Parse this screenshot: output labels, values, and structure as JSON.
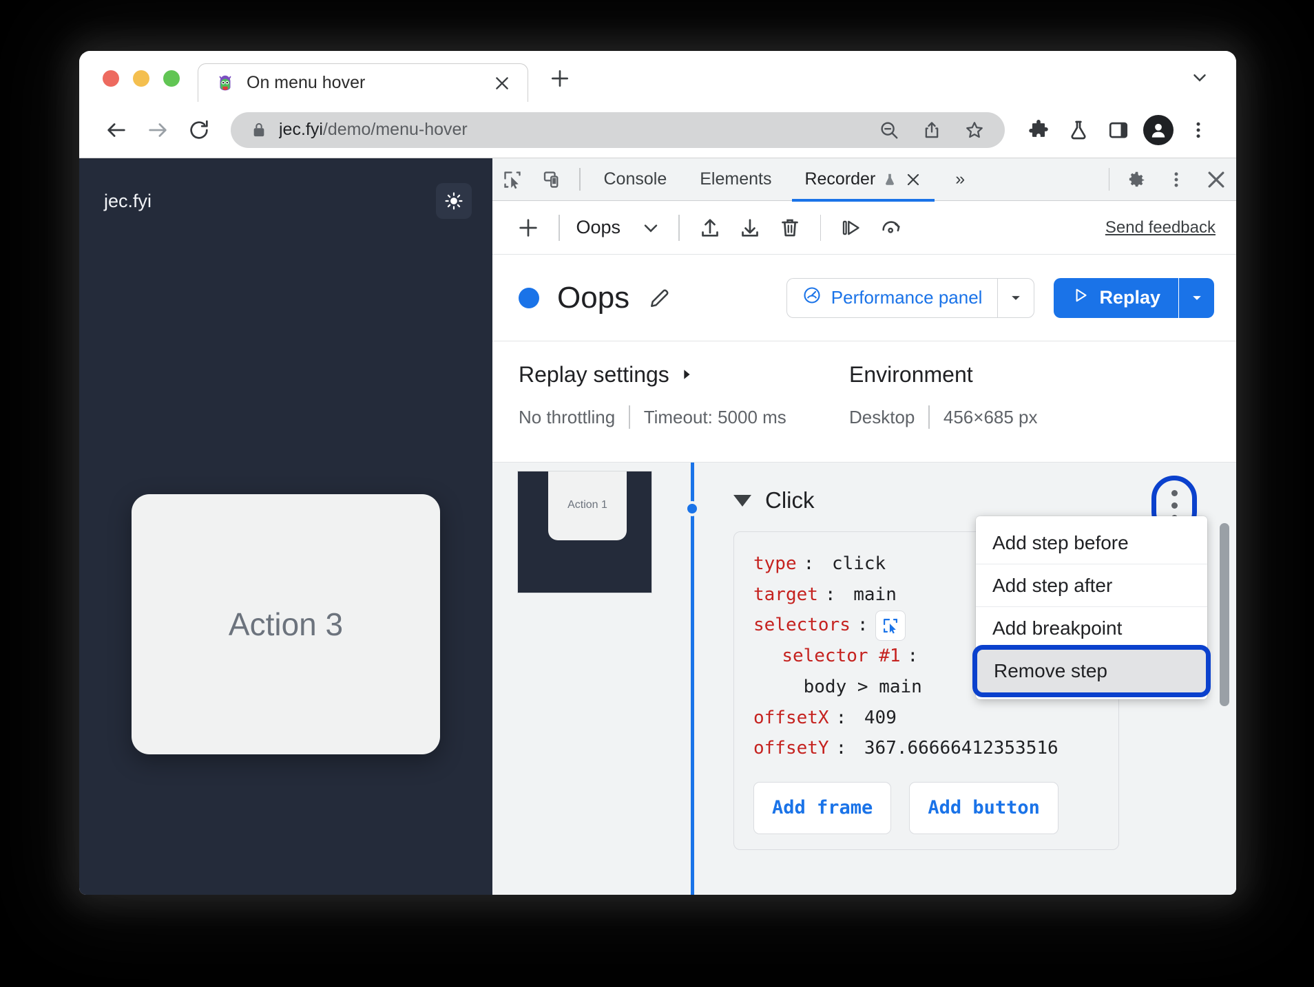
{
  "browser": {
    "tab": {
      "title": "On menu hover",
      "favicon": "monster-favicon",
      "close": "×"
    },
    "new_tab_label": "+",
    "tablist_caret": "chevron-down-icon",
    "omnibox": {
      "url_host": "jec.fyi",
      "url_path": "/demo/menu-hover",
      "lock": "lock-icon",
      "zoom_out": "zoom-out-icon",
      "share": "share-icon",
      "bookmark": "star-icon"
    },
    "toolbar": {
      "back": "back-arrow-icon",
      "forward": "forward-arrow-icon",
      "reload": "reload-icon",
      "extensions": "puzzle-icon",
      "labs": "flask-icon",
      "side_panel": "side-panel-icon",
      "profile": "profile-avatar-icon",
      "menu": "kebab-menu-icon"
    }
  },
  "page": {
    "brand": "jec.fyi",
    "theme_toggle": "sun-icon",
    "card_label": "Action 3"
  },
  "devtools": {
    "inspect_icon": "inspect-cursor-icon",
    "device_icon": "device-toolbar-icon",
    "tabs": [
      {
        "label": "Console",
        "active": false
      },
      {
        "label": "Elements",
        "active": false
      },
      {
        "label": "Recorder",
        "active": true,
        "experimental_icon": "flask-icon",
        "close": "×"
      }
    ],
    "more_tabs": "»",
    "settings_icon": "gear-icon",
    "more_options_icon": "kebab-menu-icon",
    "close_icon": "close-icon"
  },
  "recorder_toolbar": {
    "add_recording": "+",
    "recording_name": "Oops",
    "name_caret": "chevron-down-icon",
    "export_icon": "upload-icon",
    "import_icon": "download-icon",
    "delete_icon": "trash-icon",
    "step_by_step_icon": "step-play-icon",
    "slow_replay_icon": "speed-dial-icon",
    "feedback_label": "Send feedback"
  },
  "recording": {
    "status_dot_color": "#1a73e8",
    "title": "Oops",
    "edit_icon": "pencil-icon",
    "perf_panel_label": "Performance panel",
    "perf_panel_icon": "performance-icon",
    "perf_panel_caret": "chevron-down-icon",
    "replay_label": "Replay",
    "replay_icon": "play-icon",
    "replay_caret": "chevron-down-icon"
  },
  "settings": {
    "replay_heading": "Replay settings",
    "replay_heading_caret": "chevron-right-icon",
    "throttling": "No throttling",
    "timeout": "Timeout: 5000 ms",
    "environment_heading": "Environment",
    "device": "Desktop",
    "viewport": "456×685 px"
  },
  "steps": {
    "thumbnail_label": "Action 1",
    "step_title": "Click",
    "step_caret": "caret-down-icon",
    "menu_button": "kebab-menu-icon",
    "code": {
      "type_key": "type",
      "type_value": "click",
      "target_key": "target",
      "target_value": "main",
      "selectors_key": "selectors",
      "selector_picker_icon": "selector-picker-icon",
      "selector1_key": "selector #1",
      "selector1_value": "body > main",
      "offsetx_key": "offsetX",
      "offsetx_value": "409",
      "offsety_key": "offsetY",
      "offsety_value": "367.66666412353516"
    },
    "add_frame_label": "Add frame",
    "add_button_label": "Add button"
  },
  "context_menu": {
    "items": [
      {
        "label": "Add step before",
        "selected": false
      },
      {
        "label": "Add step after",
        "selected": false
      },
      {
        "label": "Add breakpoint",
        "selected": false
      },
      {
        "label": "Remove step",
        "selected": true
      }
    ]
  },
  "colors": {
    "accent": "#1a73e8",
    "highlight_outline": "#0b41cd",
    "page_bg": "#242b3a",
    "devtools_bg": "#f1f3f4",
    "code_key": "#c5221f"
  }
}
